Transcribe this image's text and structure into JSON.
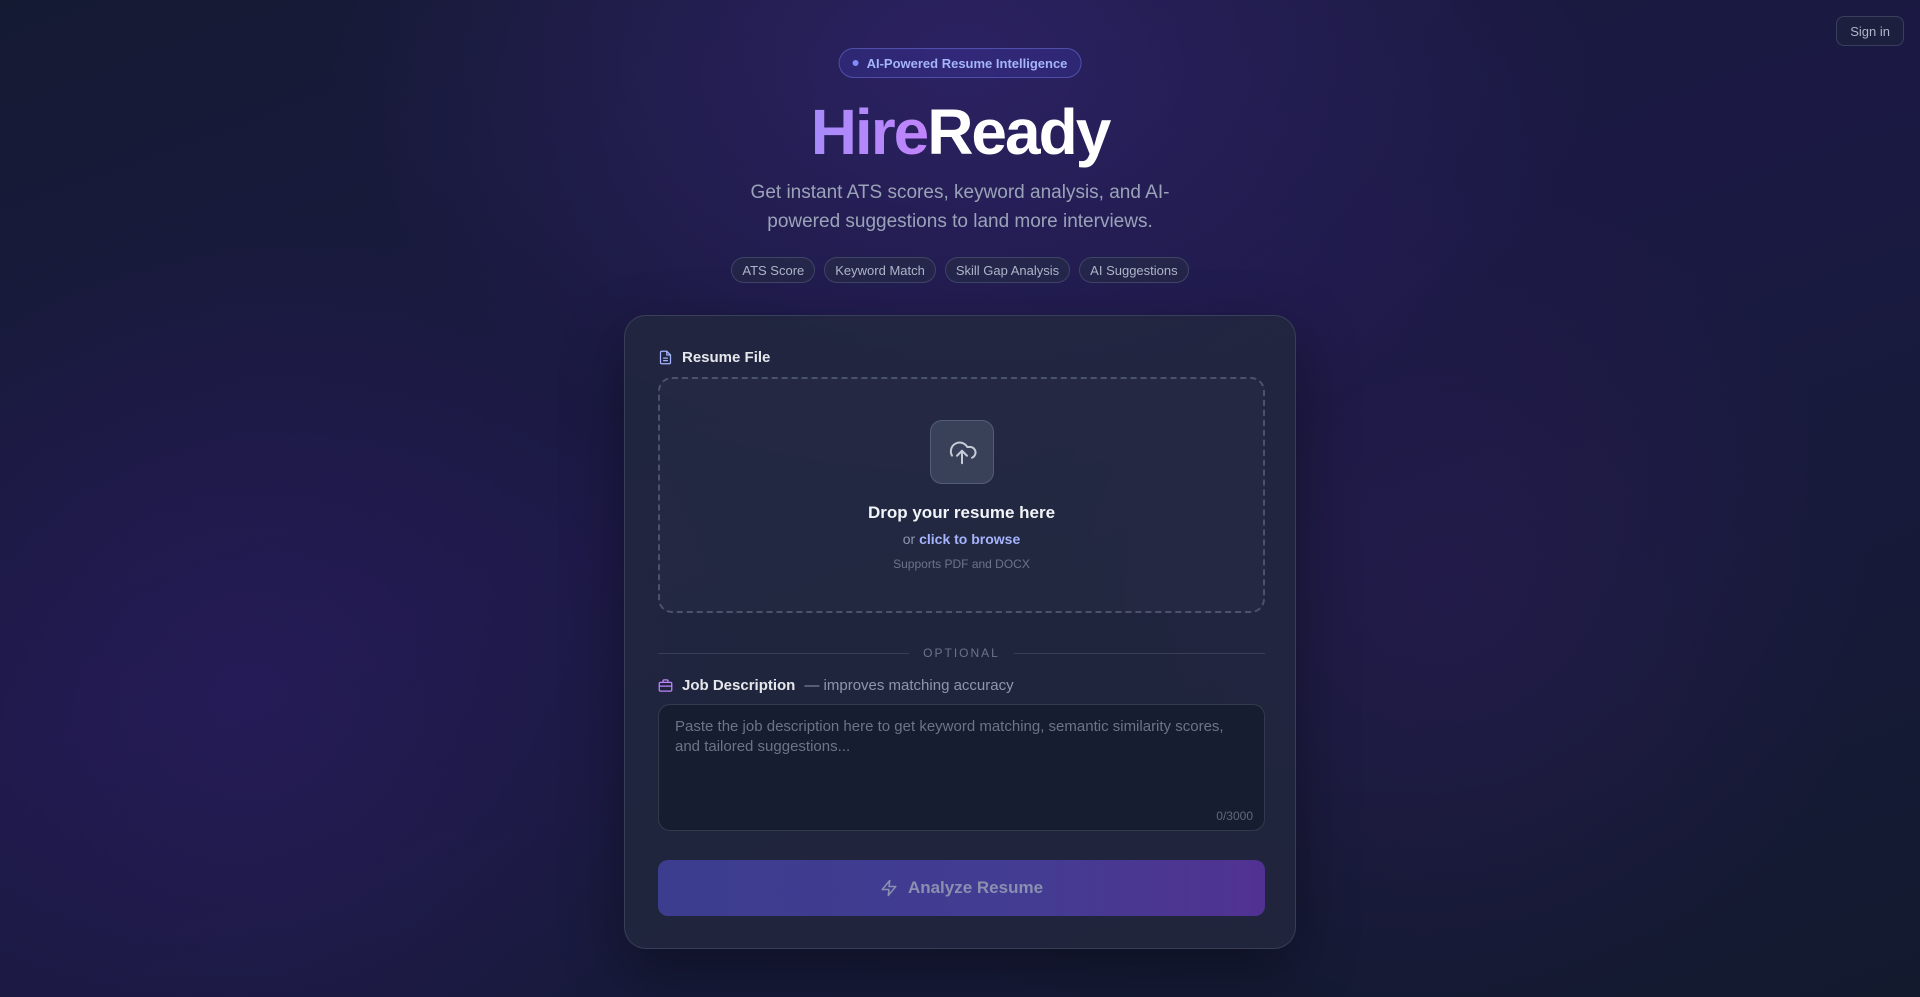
{
  "header": {
    "signin_label": "Sign in",
    "badge_text": "AI-Powered Resume Intelligence",
    "title_part1": "Hire",
    "title_part2": "Ready",
    "subtitle": "Get instant ATS scores, keyword analysis, and AI-powered suggestions to land more interviews.",
    "features": [
      "ATS Score",
      "Keyword Match",
      "Skill Gap Analysis",
      "AI Suggestions"
    ]
  },
  "form": {
    "resume_label": "Resume File",
    "resume_icon": "document-icon",
    "drop_title": "Drop your resume here",
    "drop_or": "or",
    "browse_link": "click to browse",
    "formats": "Supports PDF and DOCX",
    "upload_icon": "cloud-upload-icon",
    "divider_text": "OPTIONAL",
    "jd_label": "Job Description",
    "jd_hint": "— improves matching accuracy",
    "jd_icon": "briefcase-icon",
    "jd_placeholder": "Paste the job description here to get keyword matching, semantic similarity scores, and tailored suggestions...",
    "jd_value": "",
    "char_count": "0/3000",
    "analyze_label": "Analyze Resume",
    "analyze_icon": "lightning-icon"
  },
  "colors": {
    "accent": "#a5b4fc",
    "title_gradient_start": "#a78bfa",
    "title_gradient_end": "#c084fc",
    "button_gradient_start": "#3c3d8f",
    "button_gradient_end": "#513292"
  }
}
